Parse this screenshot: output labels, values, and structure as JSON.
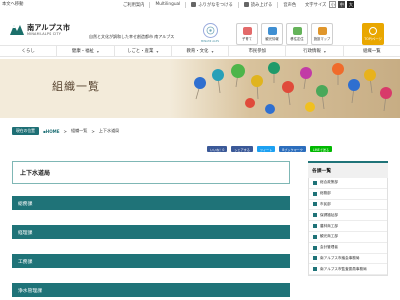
{
  "topbar": {
    "skip": "本文へ移動",
    "links": [
      "ご利用案内",
      "Multilingual",
      "ふりがなをつける",
      "読み上げる",
      "音声色"
    ],
    "size_label": "文字サイズ",
    "sizes": [
      "小",
      "中",
      "大"
    ]
  },
  "header": {
    "logo_name": "南アルプス市",
    "logo_sub": "MINAMI-ALPS CITY",
    "tagline": "自然と文化が調和した幸せ創造都市 南アルプス",
    "badge_text": "MINAMI ALPS",
    "quick": [
      {
        "label": "子育て",
        "color": "#e36a6a"
      },
      {
        "label": "観光情報",
        "color": "#3f8fd2"
      },
      {
        "label": "移住定住",
        "color": "#65b35a"
      },
      {
        "label": "施設マップ",
        "color": "#e0962b"
      }
    ],
    "lang_label": "TOP/ページ"
  },
  "gnav": [
    "くらし",
    "健康・福祉",
    "しごと・産業",
    "教育・文化",
    "市民参加",
    "行政情報",
    "組織一覧"
  ],
  "banner": {
    "title": "組織一覧"
  },
  "breadcrumb": {
    "here": "現在の位置",
    "home": "HOME",
    "items": [
      "組織一覧",
      "上下水道局"
    ]
  },
  "share": [
    {
      "label": "いいね！0",
      "color": "#3b5998"
    },
    {
      "label": "シェアする",
      "color": "#3b5998"
    },
    {
      "label": "ツイート",
      "color": "#1da1f2"
    },
    {
      "label": "Bブックマーク",
      "color": "#2c6ebd"
    },
    {
      "label": "LINEで送る",
      "color": "#00b900"
    }
  ],
  "main": {
    "title": "上下水道局",
    "sections": [
      "総務課",
      "経理課",
      "工務課",
      "浄水管理課"
    ]
  },
  "sidebar": {
    "heading": "各課一覧",
    "items": [
      "総合政策部",
      "総務部",
      "市民部",
      "保健福祉部",
      "農林商工部",
      "観光商工部",
      "会計管理者",
      "南アルプス市議会事務局",
      "南アルプス市監査委員事務局"
    ]
  }
}
